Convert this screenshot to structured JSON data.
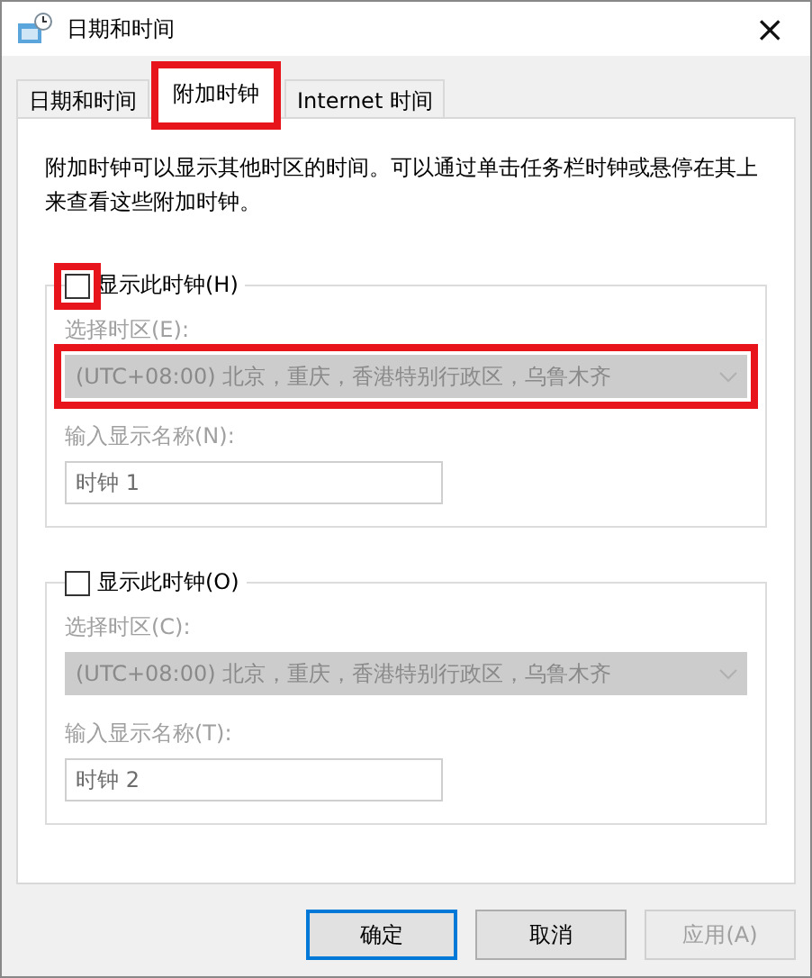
{
  "window": {
    "title": "日期和时间",
    "close": "×"
  },
  "tabs": [
    {
      "label": "日期和时间",
      "selected": false,
      "highlighted": false
    },
    {
      "label": "附加时钟",
      "selected": true,
      "highlighted": true
    },
    {
      "label": "Internet 时间",
      "selected": false,
      "highlighted": false
    }
  ],
  "description": "附加时钟可以显示其他时区的时间。可以通过单击任务栏时钟或悬停在其上来查看这些附加时钟。",
  "clocks": [
    {
      "label": "显示此时钟(H)",
      "checked": false,
      "checkbox_highlighted": true,
      "timezone_label": "选择时区(E):",
      "timezone": "(UTC+08:00) 北京，重庆，香港特别行政区，乌鲁木齐",
      "timezone_highlighted": true,
      "name_label": "输入显示名称(N):",
      "name": "时钟 1"
    },
    {
      "label": "显示此时钟(O)",
      "checked": false,
      "checkbox_highlighted": false,
      "timezone_label": "选择时区(C):",
      "timezone": "(UTC+08:00) 北京，重庆，香港特别行政区，乌鲁木齐",
      "timezone_highlighted": false,
      "name_label": "输入显示名称(T):",
      "name": "时钟 2"
    }
  ],
  "buttons": [
    {
      "label": "确定",
      "kind": "default",
      "disabled": false
    },
    {
      "label": "取消",
      "kind": "normal",
      "disabled": false
    },
    {
      "label": "应用(A)",
      "kind": "normal",
      "disabled": true
    }
  ]
}
